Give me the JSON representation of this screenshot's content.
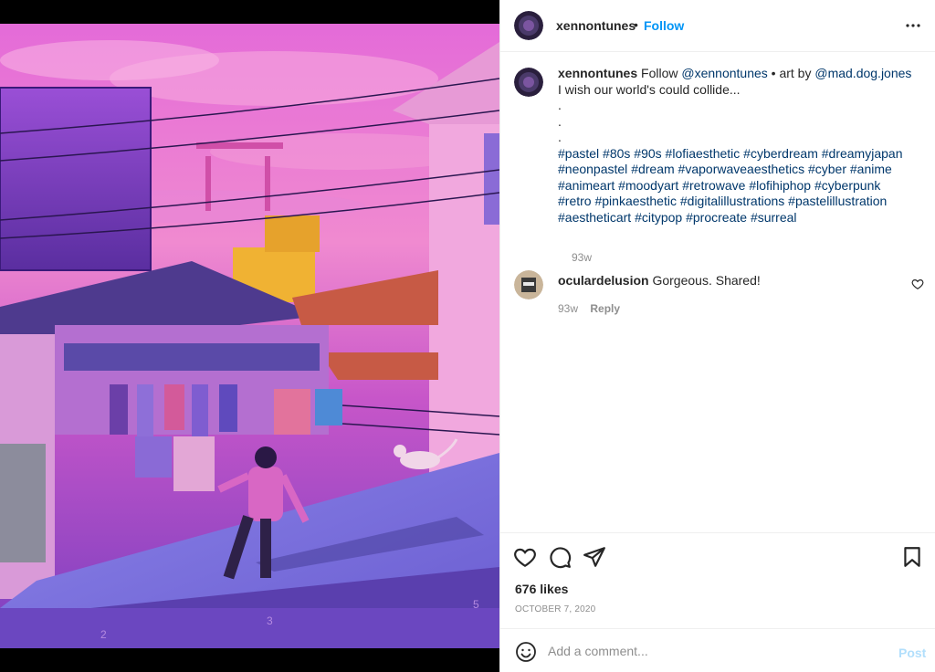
{
  "post": {
    "author": "xennontunes",
    "follow_label": "Follow",
    "separator": "•",
    "more_icon": "more-horizontal-icon"
  },
  "caption": {
    "username": "xennontunes",
    "pre": "Follow",
    "mention1": "@xennontunes",
    "mid": " • art by ",
    "mention2": "@mad.dog.jones",
    "post": " I wish our world's could collide...",
    "dots": [
      ".",
      ".",
      "."
    ],
    "hashtags": [
      "#pastel",
      "#80s",
      "#90s",
      "#lofiaesthetic",
      "#cyberdream",
      "#dreamyjapan",
      "#neonpastel",
      "#dream",
      "#vaporwaveaesthetics",
      "#cyber",
      "#anime",
      "#animeart",
      "#moodyart",
      "#retrowave",
      "#lofihiphop",
      "#cyberpunk",
      "#retro",
      "#pinkaesthetic",
      "#digitalillustrations",
      "#pastelillustration",
      "#aestheticart",
      "#citypop",
      "#procreate",
      "#surreal"
    ],
    "time": "93w"
  },
  "comment": {
    "username": "oculardelusion",
    "text": "Gorgeous. Shared!",
    "time": "93w",
    "reply_label": "Reply"
  },
  "actions": {
    "likes": "676 likes",
    "date": "OCTOBER 7, 2020"
  },
  "composer": {
    "placeholder": "Add a comment...",
    "post_label": "Post"
  },
  "colors": {
    "link": "#00376b",
    "follow": "#0095f6",
    "post_disabled": "#b2dffc",
    "muted": "#8e8e8e"
  }
}
